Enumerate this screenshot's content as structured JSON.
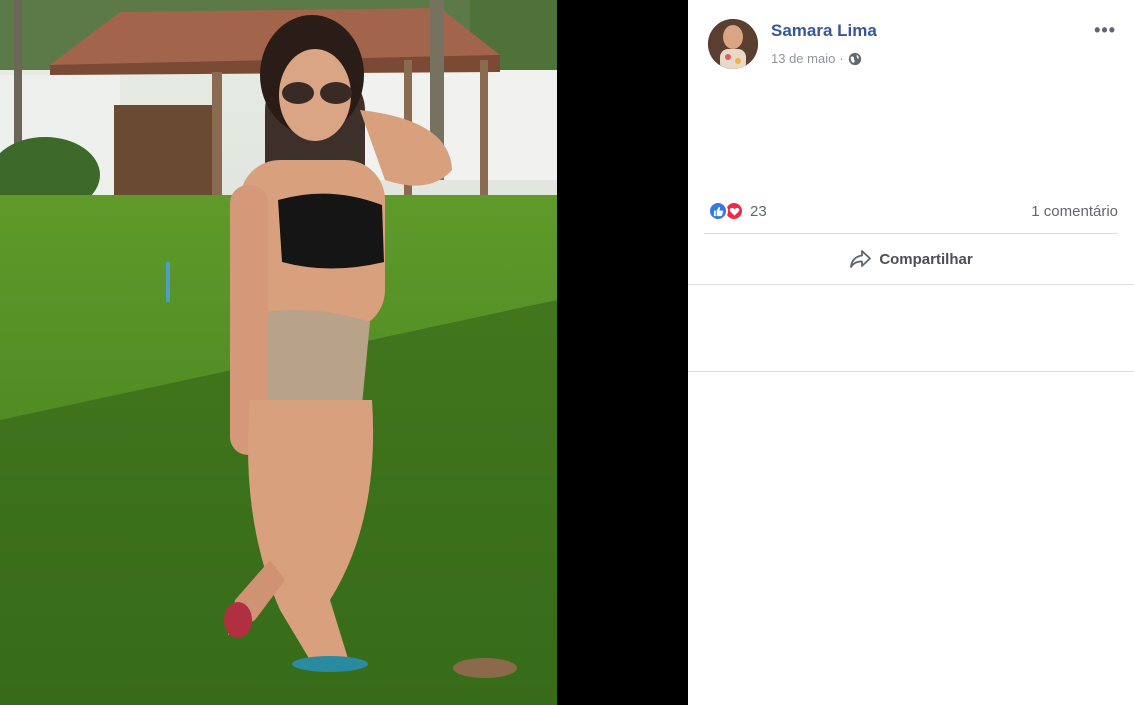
{
  "post": {
    "author": "Samara Lima",
    "date": "13 de maio",
    "privacy_icon": "globe-icon",
    "menu_icon": "more-options-icon",
    "more_label": "•••"
  },
  "reactions": {
    "count": "23",
    "types": [
      "like-icon",
      "love-icon"
    ],
    "comments": "1 comentário"
  },
  "actions": {
    "share_label": "Compartilhar"
  },
  "colors": {
    "author": "#365899",
    "meta": "#90949c",
    "like": "#3578e5",
    "love": "#f0284a"
  }
}
